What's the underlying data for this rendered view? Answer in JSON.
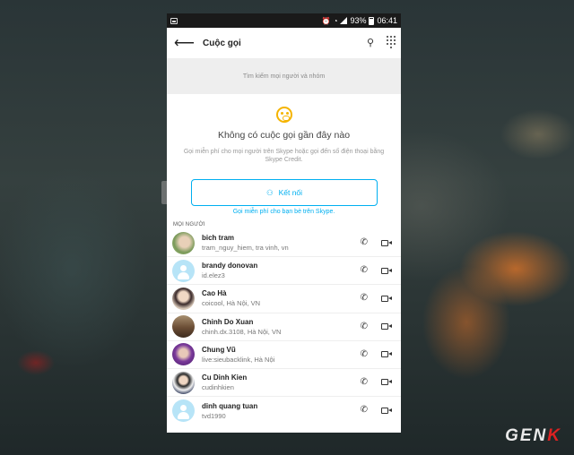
{
  "status_bar": {
    "battery_percent": "93%",
    "time": "06:41"
  },
  "app_bar": {
    "title": "Cuộc gọi",
    "back_icon": "arrow-left-icon",
    "add_icon": "add-people-icon",
    "dialpad_icon": "dialpad-icon"
  },
  "search": {
    "placeholder": "Tìm kiếm mọi người và nhóm"
  },
  "empty_state": {
    "title": "Không có cuộc gọi gần đây nào",
    "description": "Gọi miễn phí cho mọi người trên Skype hoặc gọi đến số điện thoại bằng Skype Credit.",
    "connect_label": "Kết nối",
    "invite_text": "Gọi miễn phí cho bạn bè trên Skype."
  },
  "contacts": {
    "section_label": "MỌI NGƯỜI",
    "items": [
      {
        "name": "bich tram",
        "subtitle": "tram_nguy_hiem, tra vinh, vn",
        "avatar": "photo",
        "avatar_color": "#8aa36a"
      },
      {
        "name": "brandy donovan",
        "subtitle": "id.elez3",
        "avatar": "default",
        "avatar_color": "#b7e4f7"
      },
      {
        "name": "Cao Hà",
        "subtitle": "coicool, Hà Nội, VN",
        "avatar": "photo",
        "avatar_color": "#c9b7a8"
      },
      {
        "name": "Chinh Do Xuan",
        "subtitle": "chinh.dx.3108, Hà Nội, VN",
        "avatar": "photo",
        "avatar_color": "#6b4d35"
      },
      {
        "name": "Chung Vũ",
        "subtitle": "live:sieubacklink, Hà Nội",
        "avatar": "photo",
        "avatar_color": "#5a2a7a"
      },
      {
        "name": "Cu Dinh Kien",
        "subtitle": "cudinhkien",
        "avatar": "photo",
        "avatar_color": "#3b3f52"
      },
      {
        "name": "dinh quang tuan",
        "subtitle": "tvd1990",
        "avatar": "default",
        "avatar_color": "#b7e4f7"
      }
    ]
  },
  "watermark": {
    "text": "GEN",
    "accent": "K"
  },
  "colors": {
    "accent": "#00aff0",
    "emoji": "#f5b400"
  }
}
